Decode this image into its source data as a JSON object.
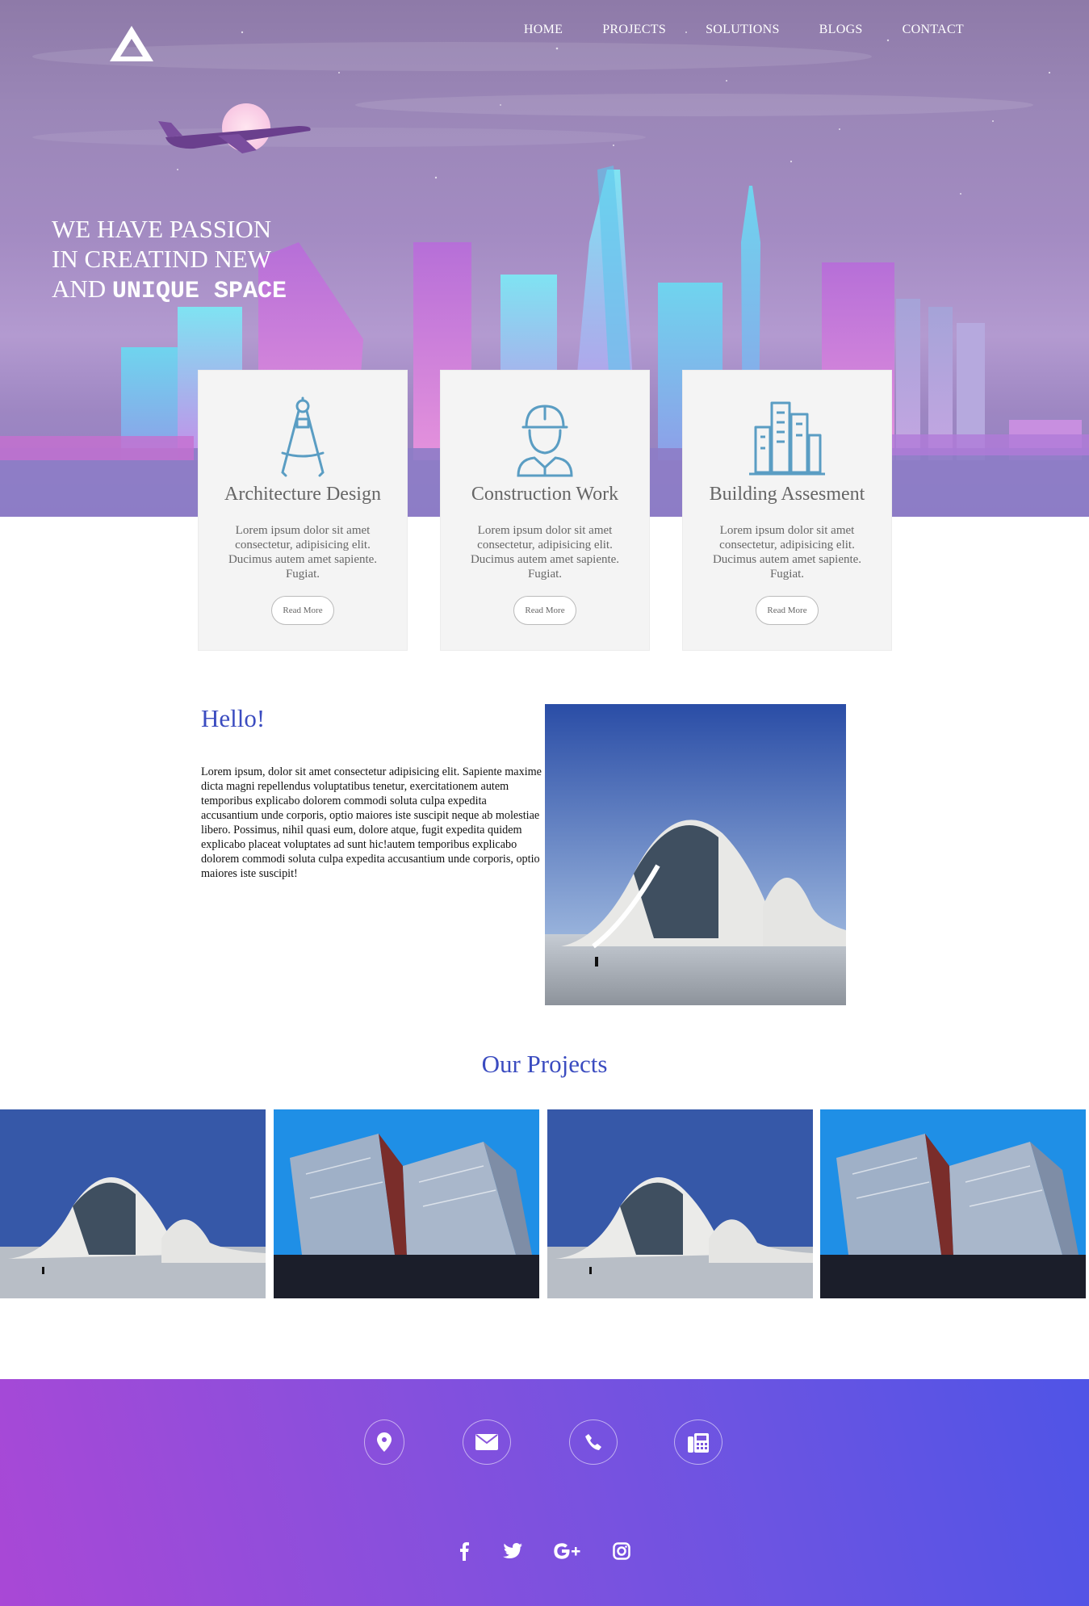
{
  "nav": {
    "logo_icon": "triangle-logo-icon",
    "items": [
      "HOME",
      "PROJECTS",
      "SOLUTIONS",
      "BLOGS",
      "CONTACT"
    ]
  },
  "hero": {
    "line1": "WE HAVE PASSION",
    "line2": "IN CREATIND NEW",
    "line3_prefix": "AND ",
    "line3_emphasis": "UNIQUE SPACE"
  },
  "services": [
    {
      "icon": "compass-icon",
      "title": "Architecture Design",
      "text": "Lorem ipsum dolor sit amet consectetur, adipisicing elit. Ducimus autem amet sapiente. Fugiat.",
      "button": "Read More"
    },
    {
      "icon": "worker-icon",
      "title": "Construction Work",
      "text": "Lorem ipsum dolor sit amet consectetur, adipisicing elit. Ducimus autem amet sapiente. Fugiat.",
      "button": "Read More"
    },
    {
      "icon": "buildings-icon",
      "title": "Building Assesment",
      "text": "Lorem ipsum dolor sit amet consectetur, adipisicing elit. Ducimus autem amet sapiente. Fugiat.",
      "button": "Read More"
    }
  ],
  "hello": {
    "title": "Hello!",
    "text": "Lorem ipsum, dolor sit amet consectetur adipisicing elit. Sapiente maxime dicta magni repellendus voluptatibus tenetur, exercitationem autem temporibus explicabo dolorem commodi soluta culpa expedita accusantium unde corporis, optio maiores iste suscipit neque ab molestiae libero. Possimus, nihil quasi eum, dolore atque, fugit expedita quidem explicabo placeat voluptates ad sunt hic!autem temporibus explicabo dolorem commodi soluta culpa expedita accusantium unde corporis, optio maiores iste suscipit!"
  },
  "projects": {
    "title": "Our Projects",
    "images": [
      "wave-building",
      "crystal-building",
      "wave-building",
      "crystal-building"
    ]
  },
  "footer": {
    "contact_icons": [
      "map-pin-icon",
      "envelope-icon",
      "phone-icon",
      "fax-icon"
    ],
    "social_icons": [
      "facebook-icon",
      "twitter-icon",
      "google-plus-icon",
      "instagram-icon"
    ],
    "colors": {
      "start": "#a948d6",
      "end": "#4f54e6"
    }
  }
}
